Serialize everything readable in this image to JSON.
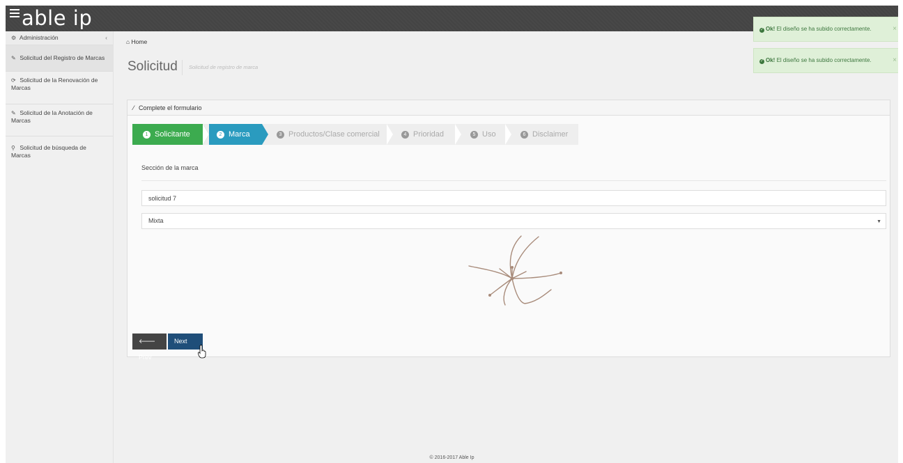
{
  "app": {
    "logo": "able ip"
  },
  "sidebar": {
    "items": [
      {
        "icon": "gears-icon",
        "glyph": "⚙",
        "label": "Administración",
        "caret": "‹"
      },
      {
        "icon": "edit-icon",
        "glyph": "✎",
        "label": "Solicitud del Registro de Marcas"
      },
      {
        "icon": "refresh-icon",
        "glyph": "⟳",
        "label": "Solicitud de la Renovación de Marcas"
      },
      {
        "icon": "pencil-icon",
        "glyph": "✎",
        "label": "Solicitud de la Anotación de Marcas"
      },
      {
        "icon": "search-icon",
        "glyph": "⚲",
        "label": "Solicitud de búsqueda de Marcas"
      }
    ]
  },
  "breadcrumb": {
    "icon": "home-icon",
    "glyph": "⌂",
    "label": "Home"
  },
  "page": {
    "title": "Solicitud",
    "subtitle": "Solicitud de registro de marca"
  },
  "panel": {
    "title": "Complete el formulario",
    "icon": "magic-wand-icon",
    "glyph": "⁄",
    "steps": [
      {
        "num": "1",
        "label": "Solicitante",
        "state": "done"
      },
      {
        "num": "2",
        "label": "Marca",
        "state": "active"
      },
      {
        "num": "3",
        "label": "Productos/Clase comercial",
        "state": "pending"
      },
      {
        "num": "4",
        "label": "Prioridad",
        "state": "pending"
      },
      {
        "num": "5",
        "label": "Uso",
        "state": "pending"
      },
      {
        "num": "6",
        "label": "Disclaimer",
        "state": "pending"
      }
    ],
    "section_label": "Sección de la marca",
    "name_value": "solicitud 7",
    "type_value": "Mixta",
    "prev_label": "Prev",
    "next_label": "Next",
    "prev_icon": "arrow-left-icon",
    "prev_glyph": "🡐"
  },
  "toasts": [
    {
      "strong": "Ok!",
      "text": " El diseño se ha subido correctamente.",
      "close": "×"
    },
    {
      "strong": "Ok!",
      "text": " El diseño se ha subido correctamente.",
      "close": "×"
    }
  ],
  "footer": "© 2016-2017 Able Ip",
  "colors": {
    "done": "#3cab4f",
    "active": "#2a9bbf",
    "next_button": "#1f4e79",
    "topbar": "#444444"
  }
}
